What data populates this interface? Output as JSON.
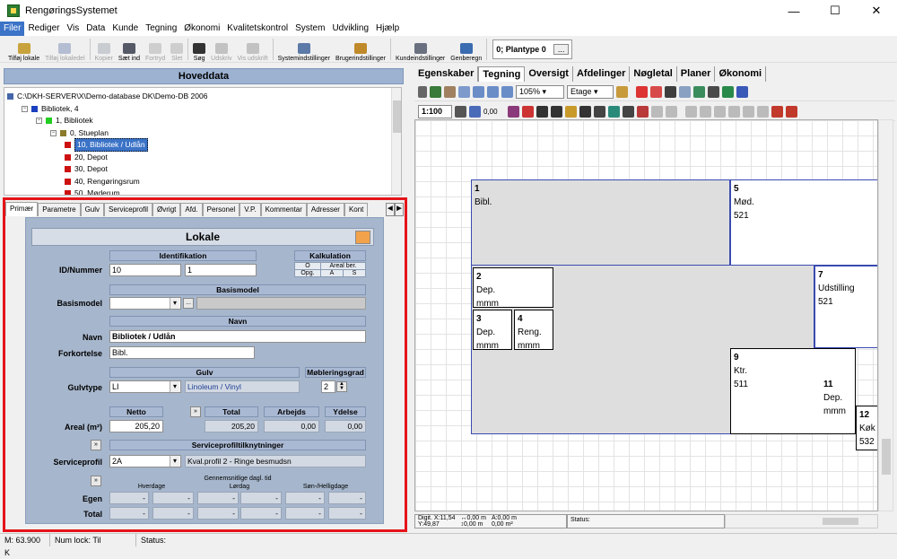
{
  "window": {
    "title": "RengøringsSystemet",
    "minimize": "—",
    "maximize": "☐",
    "close": "✕"
  },
  "menu": [
    "Filer",
    "Rediger",
    "Vis",
    "Data",
    "Kunde",
    "Tegning",
    "Økonomi",
    "Kvalitetskontrol",
    "System",
    "Udvikling",
    "Hjælp"
  ],
  "toolbar": {
    "items": [
      {
        "label": "Tilføj lokale",
        "icon": "add-room-icon",
        "enabled": true,
        "color": "#c8a23c"
      },
      {
        "label": "Tilføj lokaledel",
        "icon": "add-room-part-icon",
        "enabled": false,
        "color": "#6c7fb0"
      },
      {
        "label": "Kopier",
        "icon": "copy-icon",
        "enabled": false,
        "color": "#9aa0a8"
      },
      {
        "label": "Sæt ind",
        "icon": "paste-icon",
        "enabled": true,
        "color": "#555a66"
      },
      {
        "label": "Fortryd",
        "icon": "undo-icon",
        "enabled": false,
        "color": "#a5a5a5"
      },
      {
        "label": "Slet",
        "icon": "delete-icon",
        "enabled": false,
        "color": "#a5a5a5"
      },
      {
        "label": "Søg",
        "icon": "binoculars-icon",
        "enabled": true,
        "color": "#333"
      },
      {
        "label": "Udskriv",
        "icon": "print-icon",
        "enabled": false,
        "color": "#8a8a8a"
      },
      {
        "label": "Vis udskrift",
        "icon": "print-preview-icon",
        "enabled": false,
        "color": "#8a8a8a"
      },
      {
        "label": "Systemindstillinger",
        "icon": "system-settings-icon",
        "enabled": true,
        "color": "#5c7aa8"
      },
      {
        "label": "Brugerindstillinger",
        "icon": "user-settings-icon",
        "enabled": true,
        "color": "#c08a2a"
      },
      {
        "label": "Kundeindstillinger",
        "icon": "customer-settings-icon",
        "enabled": true,
        "color": "#6a7080"
      },
      {
        "label": "Genberegn",
        "icon": "recalculate-icon",
        "enabled": true,
        "color": "#3b6bb0"
      }
    ],
    "plantype": "0; Plantype 0",
    "plantype_more": "..."
  },
  "left": {
    "header": "Hoveddata",
    "tree": [
      {
        "text": "C:\\DKH-SERVER\\X\\Demo-database DK\\Demo-DB 2006",
        "level": 0,
        "icon": "database-icon",
        "color": "#4466aa"
      },
      {
        "text": "Bibliotek, 4",
        "level": 1,
        "icon": "customer-icon",
        "color": "#1a3fbf",
        "exp": "−"
      },
      {
        "text": "1, Bibliotek",
        "level": 2,
        "icon": "building-icon",
        "color": "#22cc22",
        "exp": "−"
      },
      {
        "text": "0, Stueplan",
        "level": 3,
        "icon": "floor-icon",
        "color": "#8a7a2a",
        "exp": "−"
      },
      {
        "text": "10, Bibliotek / Udlån",
        "level": 4,
        "icon": "room-icon",
        "color": "#cc1111",
        "selected": true
      },
      {
        "text": "20, Depot",
        "level": 4,
        "icon": "room-icon",
        "color": "#cc1111"
      },
      {
        "text": "30, Depot",
        "level": 4,
        "icon": "room-icon",
        "color": "#cc1111"
      },
      {
        "text": "40, Rengøringsrum",
        "level": 4,
        "icon": "room-icon",
        "color": "#cc1111"
      },
      {
        "text": "50, Møderum",
        "level": 4,
        "icon": "room-icon",
        "color": "#cc1111"
      }
    ],
    "tabs": [
      "Primær",
      "Parametre",
      "Gulv",
      "Serviceprofil",
      "Øvrigt",
      "Afd.",
      "Personel",
      "V.P.",
      "Kommentar",
      "Adresser",
      "Kont"
    ],
    "tab_arrows": [
      "◀",
      "▶"
    ]
  },
  "form": {
    "title": "Lokale",
    "identifikation": {
      "header": "Identifikation",
      "label": "ID/Nummer",
      "id": "10",
      "nummer": "1"
    },
    "kalkulation": {
      "header": "Kalkulation",
      "c1": "O",
      "c2": "Areal ber.",
      "c3": "Opg.",
      "c4": "A",
      "c5": "S"
    },
    "basismodel": {
      "header": "Basismodel",
      "label": "Basismodel",
      "value": "",
      "btn": "..."
    },
    "navn": {
      "header": "Navn",
      "label": "Navn",
      "value": "Bibliotek / Udlån",
      "forkortelse_label": "Forkortelse",
      "forkortelse": "Bibl."
    },
    "gulv": {
      "header": "Gulv",
      "label": "Gulvtype",
      "value": "LI",
      "desc": "Linoleum / Vinyl"
    },
    "moblering": {
      "header": "Møbleringsgrad",
      "value": "2"
    },
    "areal": {
      "label": "Areal (m²)",
      "netto_header": "Netto",
      "netto": "205,20",
      "total_header": "Total",
      "total": "205,20",
      "arbejds_header": "Arbejds",
      "arbejds": "0,00",
      "ydelse_header": "Ydelse",
      "ydelse": "0,00",
      "btn": "»"
    },
    "service": {
      "header": "Serviceprofiltilknytninger",
      "label": "Serviceprofil",
      "value": "2A",
      "desc": "Kval.profil 2 - Ringe besmudsn",
      "btn": "»"
    },
    "tid": {
      "header": "Gennemsnitlige dagl. tid",
      "hverdage": "Hverdage",
      "lordag": "Lørdag",
      "sonhellig": "Søn-/Helligdage",
      "egen_label": "Egen",
      "total_label": "Total",
      "dash": "-",
      "btn": "»"
    }
  },
  "right": {
    "tabs": [
      "Egenskaber",
      "Tegning",
      "Oversigt",
      "Afdelinger",
      "Nøgletal",
      "Planer",
      "Økonomi"
    ],
    "active_tab": "Tegning",
    "zoom": "105%",
    "level": "Etage",
    "scale": "1:100",
    "lineweight": "0,00",
    "rooms": [
      {
        "num": "1",
        "name": "Bibl.",
        "area": ""
      },
      {
        "num": "5",
        "name": "Mød.",
        "area": "521"
      },
      {
        "num": "2",
        "name": "Dep.",
        "area": "mmm"
      },
      {
        "num": "7",
        "name": "Udstilling",
        "area": "521"
      },
      {
        "num": "3",
        "name": "Dep.",
        "area": "mmm"
      },
      {
        "num": "4",
        "name": "Reng.",
        "area": "mmm"
      },
      {
        "num": "9",
        "name": "Ktr.",
        "area": "511"
      },
      {
        "num": "11",
        "name": "Dep.",
        "area": "mmm"
      },
      {
        "num": "12",
        "name": "Køk",
        "area": "532"
      }
    ],
    "coords": {
      "digit_label": "Digit.",
      "x": "X:11,54",
      "y": "Y:49,87",
      "dx": "↔0,00 m",
      "dy": "↕0,00 m",
      "a": "A:0,00 m",
      "area": "0,00 m²"
    },
    "status_label": "Status:"
  },
  "statusbar": {
    "memory": "M: 63.900 K",
    "numlock": "Num lock: Til",
    "status": "Status:"
  }
}
